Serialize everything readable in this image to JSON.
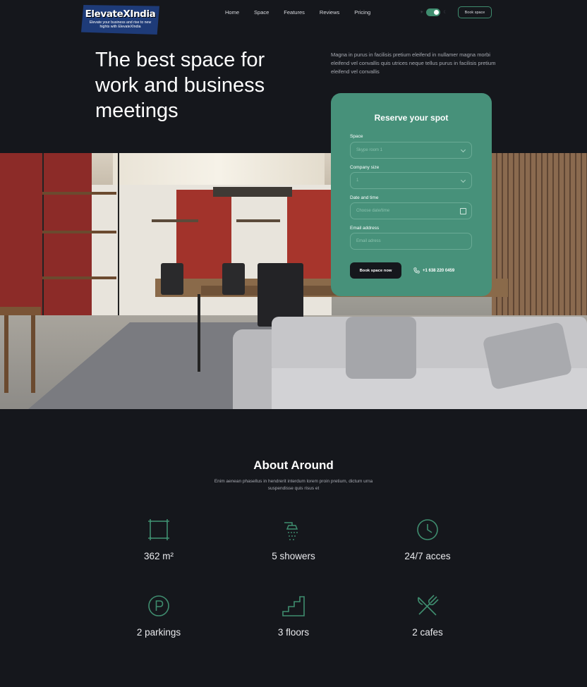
{
  "brand": {
    "name": "ElevateXIndia",
    "tagline": "Elevate your business and rise to new hights with ElevateXIndia"
  },
  "nav": {
    "items": [
      "Home",
      "Space",
      "Features",
      "Reviews",
      "Pricing"
    ],
    "cta": "Book space"
  },
  "hero": {
    "headline": "The best space for work and business meetings",
    "description": "Magna in purus in facilisis pretium eleifend in nullamer magna morbi eleifend vel convallis quis utrices neque tellus purus in facilisis pretium  eleifend vel convallis"
  },
  "form": {
    "title": "Reserve your spot",
    "space_label": "Space",
    "space_value": "Skype room 1",
    "company_label": "Company size",
    "company_value": "1",
    "date_label": "Date and time",
    "date_placeholder": "Choose date/time",
    "email_label": "Email address",
    "email_placeholder": "Email adress",
    "submit": "Book space now",
    "phone": "+1 638 220 0459"
  },
  "about": {
    "title": "About Around",
    "description": "Enim aenean phasellus in hendrerit interdum lorem proin pretium, dictum urna suspendisse quis risus et",
    "features": [
      {
        "label": "362 m²",
        "icon": "area-icon"
      },
      {
        "label": "5 showers",
        "icon": "shower-icon"
      },
      {
        "label": "24/7 acces",
        "icon": "clock-icon"
      },
      {
        "label": "2 parkings",
        "icon": "parking-icon"
      },
      {
        "label": "3 floors",
        "icon": "stairs-icon"
      },
      {
        "label": "2 cafes",
        "icon": "cutlery-icon"
      }
    ]
  },
  "colors": {
    "background": "#15171c",
    "accent": "#47917a",
    "icon": "#3f8d6f"
  }
}
